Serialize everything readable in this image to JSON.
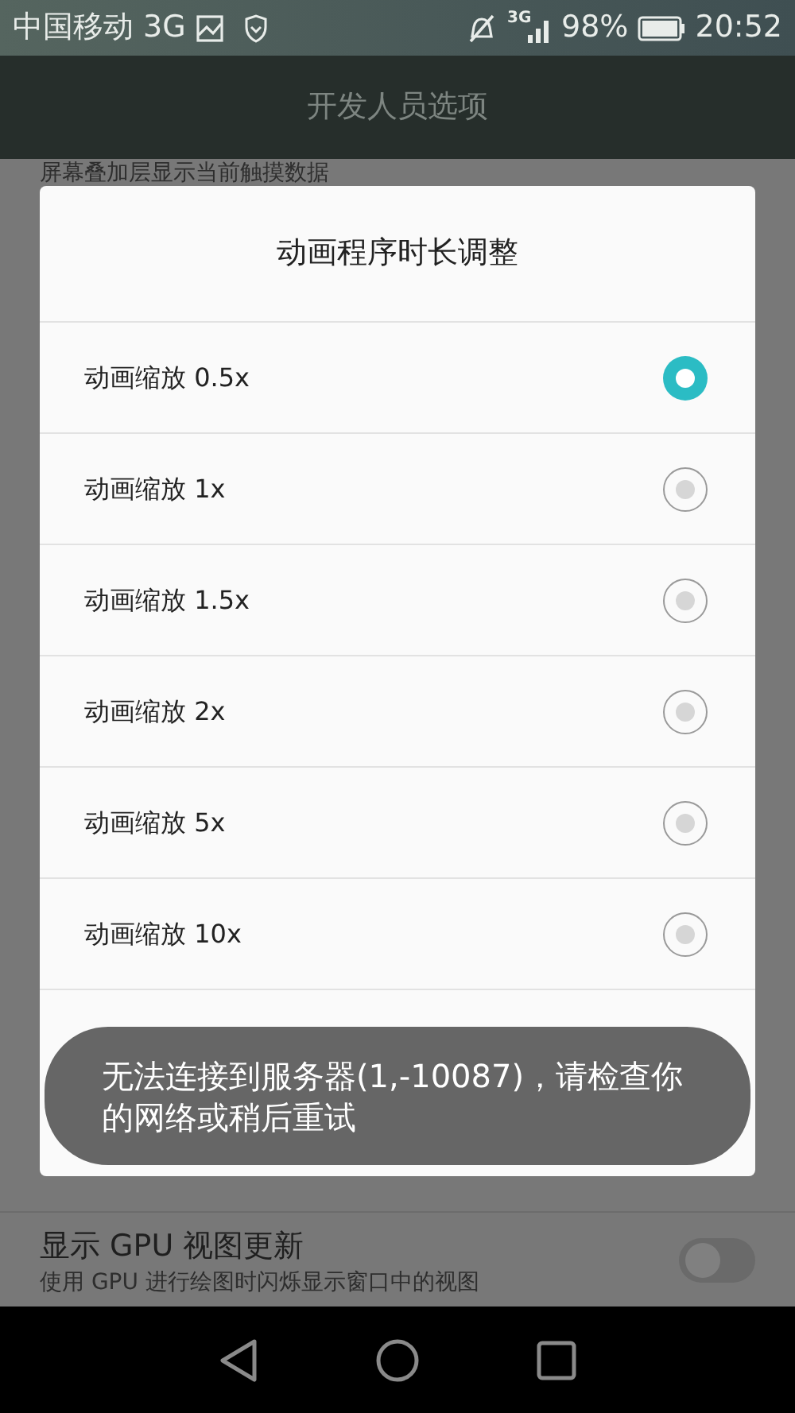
{
  "status_bar": {
    "carrier": "中国移动",
    "network": "3G",
    "signal_label": "3G",
    "battery": "98%",
    "time": "20:52"
  },
  "app_bar": {
    "title": "开发人员选项"
  },
  "background_rows": [
    {
      "kind": "subtitle",
      "subtitle": "屏幕叠加层显示当前触摸数据"
    },
    {
      "kind": "toggle",
      "on": false,
      "title": "显示 GPU 视图更新",
      "subtitle": "使用 GPU 进行绘图时闪烁显示窗口中的视图"
    }
  ],
  "dialog": {
    "title": "动画程序时长调整",
    "options": [
      {
        "label": "动画缩放 0.5x",
        "selected": true
      },
      {
        "label": "动画缩放 1x",
        "selected": false
      },
      {
        "label": "动画缩放 1.5x",
        "selected": false
      },
      {
        "label": "动画缩放 2x",
        "selected": false
      },
      {
        "label": "动画缩放 5x",
        "selected": false
      },
      {
        "label": "动画缩放 10x",
        "selected": false
      }
    ]
  },
  "toast": {
    "text": "无法连接到服务器(1,-10087)，请检查你的网络或稍后重试"
  }
}
